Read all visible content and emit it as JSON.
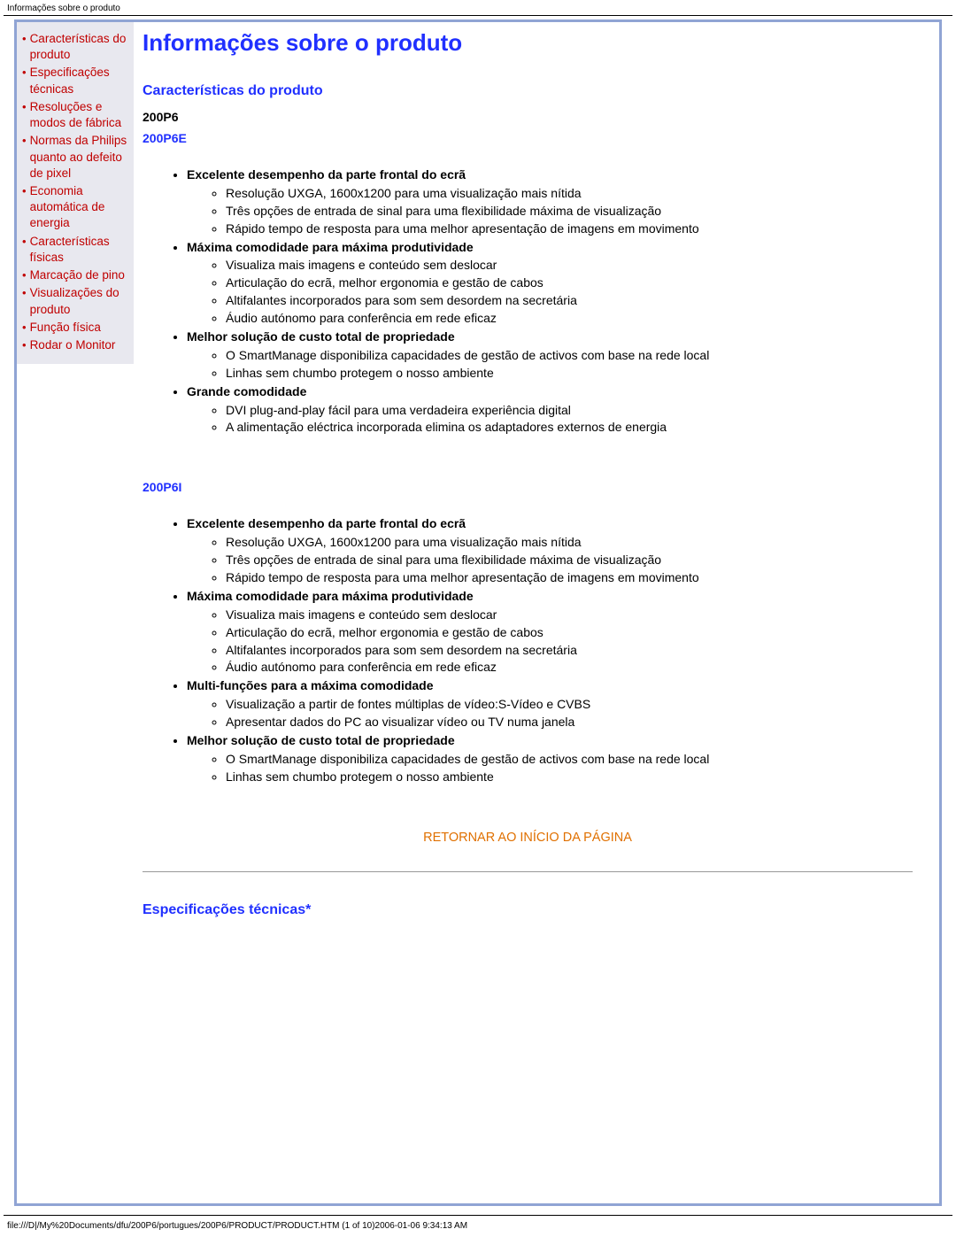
{
  "meta": {
    "header_title": "Informações sobre o produto"
  },
  "sidebar": {
    "items": [
      "Características do produto",
      "Especificações técnicas",
      "Resoluções e modos de fábrica",
      "Normas da Philips quanto ao defeito de pixel",
      "Economia automática de energia",
      "Características físicas",
      "Marcação de pino",
      "Visualizações do produto",
      "Função física",
      "Rodar o Monitor"
    ]
  },
  "page": {
    "title": "Informações sobre o produto",
    "section1_title": "Características do produto",
    "model_group": "200P6",
    "model_e": "200P6E",
    "model_i": "200P6I",
    "e": {
      "b1": "Excelente desempenho da parte frontal do ecrã",
      "b1_i1": "Resolução UXGA, 1600x1200 para uma visualização mais nítida",
      "b1_i2": "Três opções de entrada de sinal para uma flexibilidade máxima de visualização",
      "b1_i3": "Rápido tempo de resposta para uma melhor apresentação de imagens em movimento",
      "b2": "Máxima comodidade para máxima produtividade",
      "b2_i1": "Visualiza mais imagens e conteúdo sem deslocar",
      "b2_i2": "Articulação do ecrã, melhor ergonomia e gestão de cabos",
      "b2_i3": "Altifalantes incorporados para som sem desordem na secretária",
      "b2_i4": "Áudio autónomo para conferência em rede eficaz",
      "b3": "Melhor solução de custo total de propriedade",
      "b3_i1": "O SmartManage disponibiliza capacidades de gestão de activos com base na rede local",
      "b3_i2": "Linhas sem chumbo protegem o nosso ambiente",
      "b4": "Grande comodidade",
      "b4_i1": "DVI plug-and-play fácil para uma verdadeira experiência digital",
      "b4_i2": "A alimentação eléctrica incorporada elimina os adaptadores externos de energia"
    },
    "i": {
      "b1": "Excelente desempenho da parte frontal do ecrã",
      "b1_i1": "Resolução UXGA, 1600x1200 para uma visualização mais nítida",
      "b1_i2": "Três opções de entrada de sinal para uma flexibilidade máxima de visualização",
      "b1_i3": "Rápido tempo de resposta para uma melhor apresentação de imagens em movimento",
      "b2": "Máxima comodidade para máxima produtividade",
      "b2_i1": "Visualiza mais imagens e conteúdo sem deslocar",
      "b2_i2": "Articulação do ecrã, melhor ergonomia e gestão de cabos",
      "b2_i3": "Altifalantes incorporados para som sem desordem na secretária",
      "b2_i4": "Áudio autónomo para conferência em rede eficaz",
      "b3": "Multi-funções para a máxima comodidade",
      "b3_i1": "Visualização a partir de fontes múltiplas de vídeo:S-Vídeo e CVBS",
      "b3_i2": "Apresentar dados do PC ao visualizar vídeo ou TV numa janela",
      "b4": "Melhor solução de custo total de propriedade",
      "b4_i1": "O SmartManage disponibiliza capacidades de gestão de activos com base na rede local",
      "b4_i2": "Linhas sem chumbo protegem o nosso ambiente"
    },
    "return_link": "RETORNAR AO INÍCIO DA PÁGINA",
    "section2_title": "Especificações técnicas*"
  },
  "footer": {
    "text": "file:///D|/My%20Documents/dfu/200P6/portugues/200P6/PRODUCT/PRODUCT.HTM (1 of 10)2006-01-06 9:34:13 AM"
  }
}
